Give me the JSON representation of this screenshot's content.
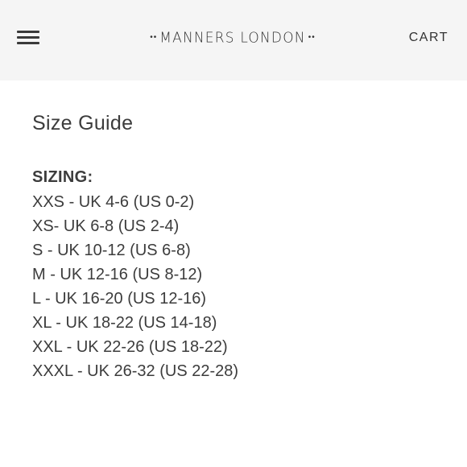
{
  "header": {
    "logo_left_dots": "••",
    "logo_text": "MANNERS LONDON",
    "logo_right_dots": "••",
    "cart_label": "CART",
    "menu_icon": "hamburger-menu-icon"
  },
  "page": {
    "title": "Size Guide",
    "sizing_heading": "SIZING:",
    "sizes": [
      "XXS - UK 4-6 (US 0-2)",
      "XS- UK 6-8 (US 2-4)",
      "S - UK 10-12 (US 6-8)",
      "M - UK 12-16 (US 8-12)",
      "L - UK 16-20 (US 12-16)",
      "XL - UK 18-22 (US 14-18)",
      "XXL - UK 22-26 (US 18-22)",
      "XXXL - UK 26-32 (US 22-28)"
    ]
  },
  "colors": {
    "header_bg": "#f5f5f5",
    "text": "#3c3c3c",
    "page_bg": "#ffffff"
  }
}
